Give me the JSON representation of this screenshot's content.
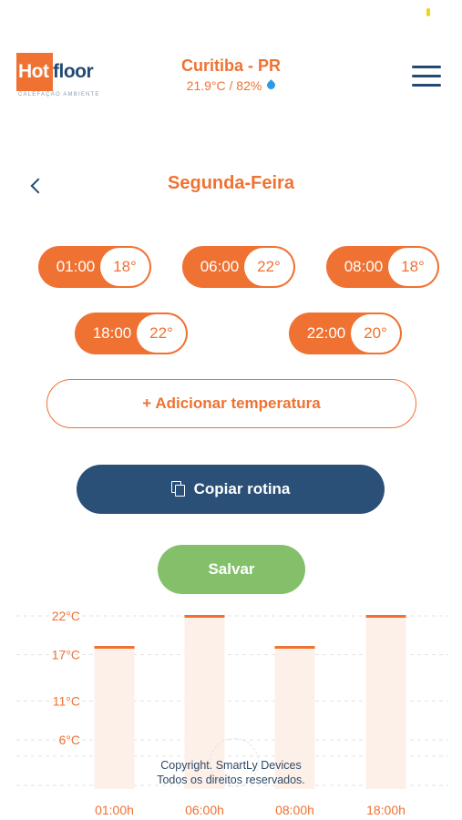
{
  "header": {
    "logo": {
      "part1": "Hot",
      "part2": "floor",
      "tagline": "CALEFAÇÃO AMBIENTE"
    },
    "city": "Curitiba - PR",
    "weather": "21.9°C / 82%",
    "weather_icon": "water-drop-icon",
    "menu_icon": "hamburger-menu-icon"
  },
  "day": {
    "title": "Segunda-Feira",
    "back_icon": "chevron-left-icon"
  },
  "schedule": [
    {
      "time": "01:00",
      "temp": "18°"
    },
    {
      "time": "06:00",
      "temp": "22°"
    },
    {
      "time": "08:00",
      "temp": "18°"
    },
    {
      "time": "18:00",
      "temp": "22°"
    },
    {
      "time": "22:00",
      "temp": "20°"
    }
  ],
  "buttons": {
    "add": "+ Adicionar temperatura",
    "copy": "Copiar rotina",
    "copy_icon": "copy-icon",
    "save": "Salvar"
  },
  "chart_data": {
    "type": "bar",
    "categories": [
      "01:00h",
      "06:00h",
      "08:00h",
      "18:00h"
    ],
    "values": [
      18,
      22,
      18,
      22
    ],
    "yticks": [
      "22°C",
      "17°C",
      "11°C",
      "6°C"
    ],
    "ytick_values": [
      22,
      17,
      11,
      6
    ],
    "ylim": [
      0,
      22
    ],
    "grid": true,
    "colors": {
      "bar_fill": "#fdf0e8",
      "bar_top": "#ef7232",
      "grid": "#e3e3e3",
      "tick": "#ef7232"
    }
  },
  "footer": {
    "line1": "Copyright. SmartLy Devices",
    "line2": "Todos os direitos reservados."
  },
  "colors": {
    "accent": "#ef7232",
    "navy": "#2a5078",
    "green": "#84c06a"
  }
}
